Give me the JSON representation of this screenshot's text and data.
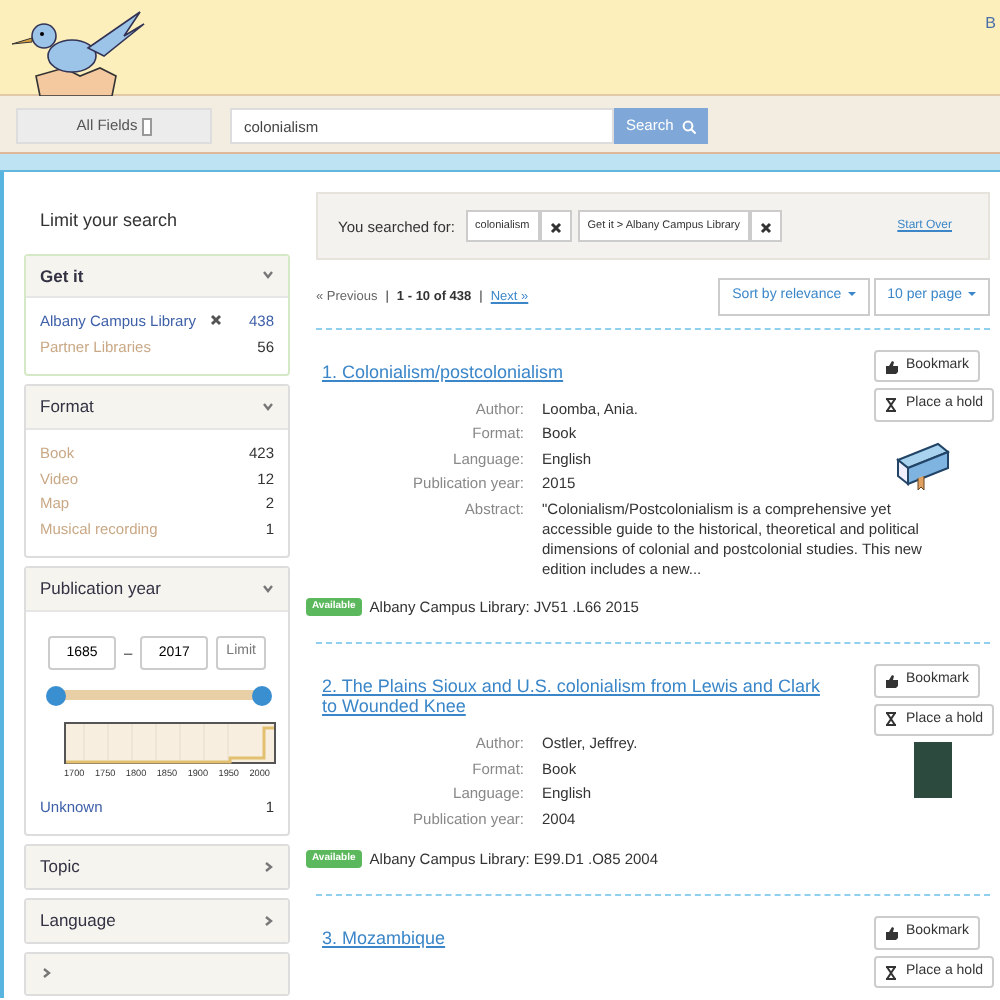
{
  "header": {
    "corner_text": "B"
  },
  "search": {
    "field_select": "All Fields",
    "query": "colonialism",
    "button": "Search"
  },
  "sidebar": {
    "title": "Limit your search",
    "facets": [
      {
        "kind": "list",
        "title": "Get it",
        "expanded": true,
        "items": [
          {
            "label": "Albany Campus Library",
            "count": "438",
            "selected": true
          },
          {
            "label": "Partner Libraries",
            "count": "56",
            "selected": false
          }
        ]
      },
      {
        "kind": "list",
        "title": "Format",
        "expanded": true,
        "items": [
          {
            "label": "Book",
            "count": "423",
            "selected": false
          },
          {
            "label": "Video",
            "count": "12",
            "selected": false
          },
          {
            "label": "Map",
            "count": "2",
            "selected": false
          },
          {
            "label": "Musical recording",
            "count": "1",
            "selected": false
          }
        ]
      },
      {
        "kind": "range",
        "title": "Publication year",
        "expanded": true,
        "from": "1685",
        "separator": "–",
        "to": "2017",
        "button": "Limit",
        "thumbs": [
          {
            "level": 0
          },
          {
            "level": 1
          }
        ],
        "axis_labels": [
          "1700",
          "1750",
          "1800",
          "1850",
          "1900",
          "1950",
          "2000"
        ],
        "items": [
          {
            "label": "Unknown",
            "count": "1",
            "selected": false
          }
        ]
      },
      {
        "title": "Topic",
        "expanded": false
      },
      {
        "title": "Language",
        "expanded": false
      },
      {
        "expanded": false
      }
    ]
  },
  "constraints": {
    "label": "You searched for:",
    "chips": [
      "colonialism",
      "Get it > Albany Campus Library"
    ],
    "start_over": "Start Over"
  },
  "pagination": {
    "previous": "« Previous",
    "separators": [
      "|",
      "|"
    ],
    "summary": "1 - 10 of 438",
    "next": "Next »",
    "sort": "Sort by relevance",
    "per_page": "10 per page"
  },
  "results": [
    {
      "number": "1.",
      "title": "Colonialism/postcolonialism",
      "kind": "icon",
      "fields": [
        {
          "label": "Author:",
          "value": "Loomba, Ania."
        },
        {
          "label": "Format:",
          "value": "Book"
        },
        {
          "label": "Language:",
          "value": "English"
        },
        {
          "label": "Publication year:",
          "value": "2015"
        },
        {
          "label": "Abstract:",
          "value": "\"Colonialism/Postcolonialism is a comprehensive yet accessible guide to the historical, theoretical and political dimensions of colonial and postcolonial studies. This new edition includes a new..."
        }
      ],
      "availability": "Available",
      "holding": "Albany Campus Library: JV51 .L66 2015",
      "buttons": [
        "Bookmark",
        "Place a hold"
      ]
    },
    {
      "number": "2.",
      "title": "The Plains Sioux and U.S. colonialism from Lewis and Clark to Wounded Knee",
      "kind": "cover",
      "fields": [
        {
          "label": "Author:",
          "value": "Ostler, Jeffrey."
        },
        {
          "label": "Format:",
          "value": "Book"
        },
        {
          "label": "Language:",
          "value": "English"
        },
        {
          "label": "Publication year:",
          "value": "2004"
        }
      ],
      "availability": "Available",
      "holding": "Albany Campus Library: E99.D1 .O85 2004",
      "buttons": [
        "Bookmark",
        "Place a hold"
      ]
    },
    {
      "number": "3.",
      "title": "Mozambique",
      "buttons": [
        "Bookmark",
        "Place a hold"
      ]
    }
  ]
}
